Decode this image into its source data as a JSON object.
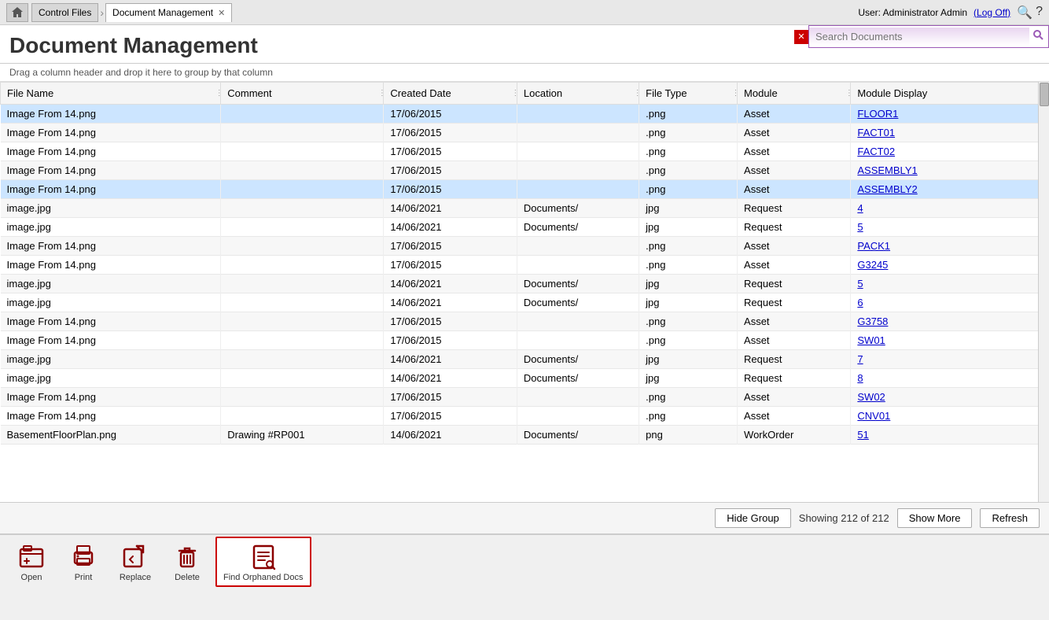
{
  "topNav": {
    "homeIcon": "🏠",
    "tabs": [
      {
        "label": "Control Files",
        "active": false
      },
      {
        "label": "Document Management",
        "active": true
      }
    ],
    "userText": "User: Administrator Admin",
    "logOffLabel": "(Log Off)"
  },
  "header": {
    "title": "Document Management",
    "searchPlaceholder": "Search Documents"
  },
  "dragHint": "Drag a column header and drop it here to group by that column",
  "columns": [
    {
      "label": "File Name"
    },
    {
      "label": "Comment"
    },
    {
      "label": "Created Date"
    },
    {
      "label": "Location"
    },
    {
      "label": "File Type"
    },
    {
      "label": "Module"
    },
    {
      "label": "Module Display"
    }
  ],
  "rows": [
    {
      "fileName": "Image From 14.png",
      "comment": "",
      "createdDate": "17/06/2015",
      "location": "",
      "fileType": ".png",
      "module": "Asset",
      "moduleDisplay": "FLOOR1",
      "highlight": true
    },
    {
      "fileName": "Image From 14.png",
      "comment": "",
      "createdDate": "17/06/2015",
      "location": "",
      "fileType": ".png",
      "module": "Asset",
      "moduleDisplay": "FACT01",
      "highlight": false
    },
    {
      "fileName": "Image From 14.png",
      "comment": "",
      "createdDate": "17/06/2015",
      "location": "",
      "fileType": ".png",
      "module": "Asset",
      "moduleDisplay": "FACT02",
      "highlight": false
    },
    {
      "fileName": "Image From 14.png",
      "comment": "",
      "createdDate": "17/06/2015",
      "location": "",
      "fileType": ".png",
      "module": "Asset",
      "moduleDisplay": "ASSEMBLY1",
      "highlight": false
    },
    {
      "fileName": "Image From 14.png",
      "comment": "",
      "createdDate": "17/06/2015",
      "location": "",
      "fileType": ".png",
      "module": "Asset",
      "moduleDisplay": "ASSEMBLY2",
      "highlight": true
    },
    {
      "fileName": "image.jpg",
      "comment": "",
      "createdDate": "14/06/2021",
      "location": "Documents/",
      "fileType": "jpg",
      "module": "Request",
      "moduleDisplay": "4",
      "highlight": false
    },
    {
      "fileName": "image.jpg",
      "comment": "",
      "createdDate": "14/06/2021",
      "location": "Documents/",
      "fileType": "jpg",
      "module": "Request",
      "moduleDisplay": "5",
      "highlight": false
    },
    {
      "fileName": "Image From 14.png",
      "comment": "",
      "createdDate": "17/06/2015",
      "location": "",
      "fileType": ".png",
      "module": "Asset",
      "moduleDisplay": "PACK1",
      "highlight": false
    },
    {
      "fileName": "Image From 14.png",
      "comment": "",
      "createdDate": "17/06/2015",
      "location": "",
      "fileType": ".png",
      "module": "Asset",
      "moduleDisplay": "G3245",
      "highlight": false
    },
    {
      "fileName": "image.jpg",
      "comment": "",
      "createdDate": "14/06/2021",
      "location": "Documents/",
      "fileType": "jpg",
      "module": "Request",
      "moduleDisplay": "5",
      "highlight": false
    },
    {
      "fileName": "image.jpg",
      "comment": "",
      "createdDate": "14/06/2021",
      "location": "Documents/",
      "fileType": "jpg",
      "module": "Request",
      "moduleDisplay": "6",
      "highlight": false
    },
    {
      "fileName": "Image From 14.png",
      "comment": "",
      "createdDate": "17/06/2015",
      "location": "",
      "fileType": ".png",
      "module": "Asset",
      "moduleDisplay": "G3758",
      "highlight": false
    },
    {
      "fileName": "Image From 14.png",
      "comment": "",
      "createdDate": "17/06/2015",
      "location": "",
      "fileType": ".png",
      "module": "Asset",
      "moduleDisplay": "SW01",
      "highlight": false
    },
    {
      "fileName": "image.jpg",
      "comment": "",
      "createdDate": "14/06/2021",
      "location": "Documents/",
      "fileType": "jpg",
      "module": "Request",
      "moduleDisplay": "7",
      "highlight": false
    },
    {
      "fileName": "image.jpg",
      "comment": "",
      "createdDate": "14/06/2021",
      "location": "Documents/",
      "fileType": "jpg",
      "module": "Request",
      "moduleDisplay": "8",
      "highlight": false
    },
    {
      "fileName": "Image From 14.png",
      "comment": "",
      "createdDate": "17/06/2015",
      "location": "",
      "fileType": ".png",
      "module": "Asset",
      "moduleDisplay": "SW02",
      "highlight": false
    },
    {
      "fileName": "Image From 14.png",
      "comment": "",
      "createdDate": "17/06/2015",
      "location": "",
      "fileType": ".png",
      "module": "Asset",
      "moduleDisplay": "CNV01",
      "highlight": false
    },
    {
      "fileName": "BasementFloorPlan.png",
      "comment": "Drawing #RP001",
      "createdDate": "14/06/2021",
      "location": "Documents/",
      "fileType": "png",
      "module": "WorkOrder",
      "moduleDisplay": "51",
      "highlight": false
    }
  ],
  "statusBar": {
    "hideGroupLabel": "Hide Group",
    "showingText": "Showing 212 of 212",
    "showMoreLabel": "Show More",
    "refreshLabel": "Refresh"
  },
  "toolbar": {
    "buttons": [
      {
        "label": "Open",
        "icon": "open"
      },
      {
        "label": "Print",
        "icon": "print"
      },
      {
        "label": "Replace",
        "icon": "replace"
      },
      {
        "label": "Delete",
        "icon": "delete"
      },
      {
        "label": "Find Orphaned Docs",
        "icon": "find-orphaned",
        "active": true
      }
    ]
  }
}
